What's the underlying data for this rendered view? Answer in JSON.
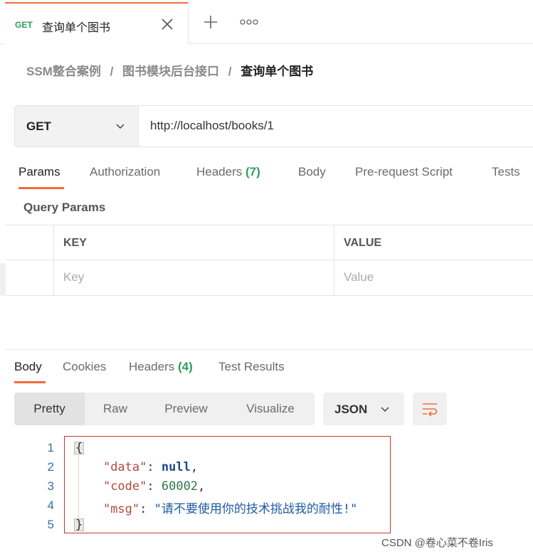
{
  "tab": {
    "method": "GET",
    "title": "查询单个图书"
  },
  "breadcrumb": {
    "items": [
      "SSM整合案例",
      "图书模块后台接口"
    ],
    "separator": "/",
    "current": "查询单个图书"
  },
  "request": {
    "method": "GET",
    "url": "http://localhost/books/1"
  },
  "request_tabs": [
    {
      "label": "Params",
      "count": "",
      "active": true
    },
    {
      "label": "Authorization",
      "count": ""
    },
    {
      "label": "Headers",
      "count": "(7)"
    },
    {
      "label": "Body",
      "count": ""
    },
    {
      "label": "Pre-request Script",
      "count": ""
    },
    {
      "label": "Tests",
      "count": ""
    }
  ],
  "query_params": {
    "title": "Query Params",
    "key_header": "KEY",
    "value_header": "VALUE",
    "key_placeholder": "Key",
    "value_placeholder": "Value"
  },
  "response_tabs": [
    {
      "label": "Body",
      "count": "",
      "active": true
    },
    {
      "label": "Cookies",
      "count": ""
    },
    {
      "label": "Headers",
      "count": "(4)"
    },
    {
      "label": "Test Results",
      "count": ""
    }
  ],
  "view_modes": [
    "Pretty",
    "Raw",
    "Preview",
    "Visualize"
  ],
  "format": "JSON",
  "code": {
    "line_numbers": [
      "1",
      "2",
      "3",
      "4",
      "5"
    ],
    "open_brace": "{",
    "close_brace": "}",
    "data_key": "\"data\"",
    "data_value": "null",
    "code_key": "\"code\"",
    "code_value": "60002",
    "msg_key": "\"msg\"",
    "msg_value": "\"请不要使用你的技术挑战我的耐性!\""
  },
  "watermark": "CSDN @卷心菜不卷Iris",
  "colors": {
    "accent": "#f26b3a",
    "method_green": "#2a9e5c",
    "highlight_box": "#c0392b"
  }
}
